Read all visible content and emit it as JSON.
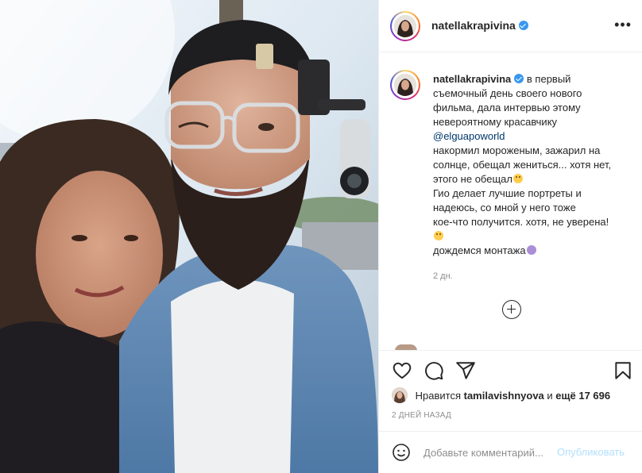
{
  "post": {
    "username": "natellakrapivina",
    "more_icon": "more-horizontal-icon",
    "photo_alt": "selfie-photo"
  },
  "caption": {
    "username": "natellakrapivina",
    "line1": "в первый",
    "line2": "съемочный день своего нового",
    "line3": "фильма, дала интервью этому",
    "line4": "невероятному красавчику",
    "mention": "@elguapoworld",
    "line5": "накормил мороженым, зажарил на",
    "line6": "солнце, обещал жениться... хотя нет,",
    "line7": "этого не обещал",
    "line8": "Гио делает лучшие портреты и",
    "line9": "надеюсь, со мной у него тоже",
    "line10": "кое-что получится. хотя, не уверена!",
    "line11": "дождемся монтажа",
    "time_ago": "2 дн."
  },
  "actions": {
    "like_icon": "heart-icon",
    "comment_icon": "comment-icon",
    "share_icon": "send-icon",
    "save_icon": "bookmark-icon"
  },
  "likes": {
    "prefix": "Нравится",
    "user": "tamilavishnyova",
    "middle": "и",
    "others": "ещё 17 696"
  },
  "date": "2 ДНЕЙ НАЗАД",
  "comment": {
    "placeholder": "Добавьте комментарий...",
    "publish_label": "Опубликовать",
    "emoji_icon": "smiley-icon"
  },
  "colors": {
    "accent": "#3897f0",
    "link": "#00376b",
    "muted": "#8e8e8e",
    "publish_disabled": "#b2dffc"
  }
}
